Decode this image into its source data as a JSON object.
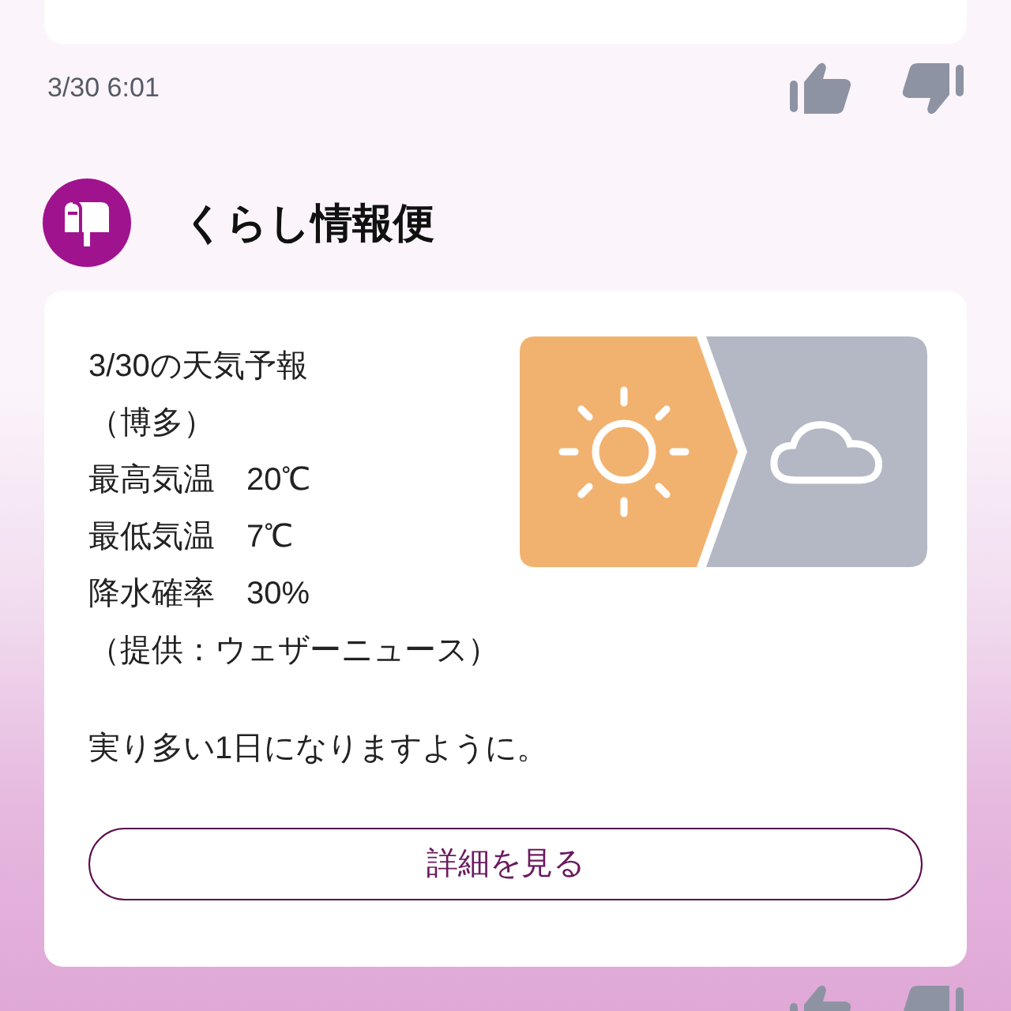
{
  "messages": [
    {
      "time": "3/30 6:01"
    }
  ],
  "post": {
    "sender": "くらし情報便",
    "lines": [
      "3/30の天気予報",
      "（博多）",
      "最高気温　20℃",
      "最低気温　7℃",
      "降水確率　30%",
      "（提供：ウェザーニュース）"
    ],
    "closing": "実り多い1日になりますように。",
    "button": "詳細を見る"
  }
}
